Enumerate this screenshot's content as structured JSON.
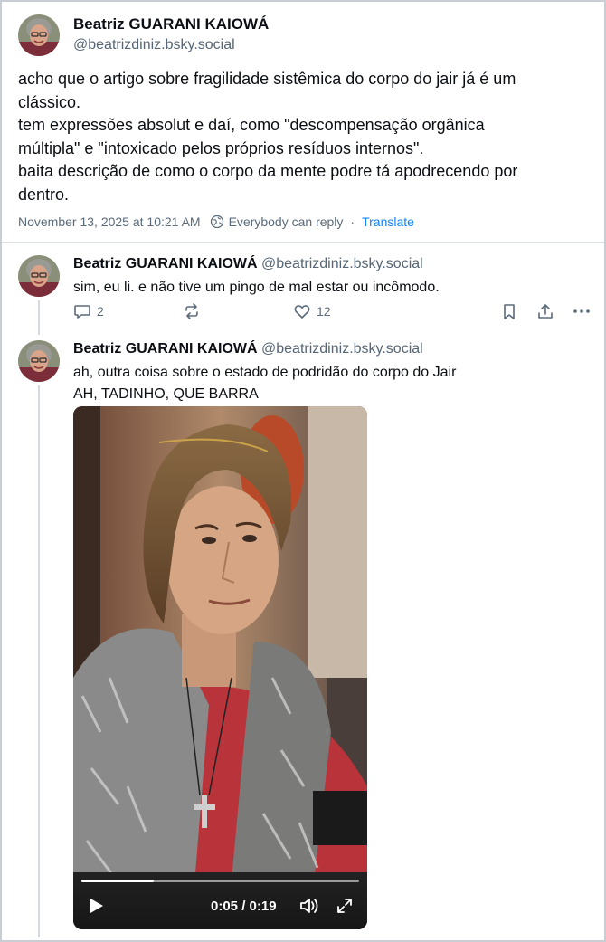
{
  "main_post": {
    "author_name": "Beatriz GUARANI KAIOWÁ",
    "author_handle": "@beatrizdiniz.bsky.social",
    "text_lines": [
      "acho que o artigo sobre fragilidade sistêmica do corpo do jair já é um",
      "clássico.",
      "tem expressões absolut e daí, como \"descompensação orgânica",
      "múltipla\" e \"intoxicado pelos próprios resíduos internos\".",
      "baita descrição de como o corpo da mente podre tá apodrecendo por",
      "dentro."
    ],
    "timestamp": "November 13, 2025 at 10:21 AM",
    "reply_setting": "Everybody can reply",
    "separator": "·",
    "translate_label": "Translate",
    "icons": {
      "avatar": "avatar",
      "globe": "globe-icon"
    }
  },
  "replies": [
    {
      "author_name": "Beatriz GUARANI KAIOWÁ",
      "author_handle": "@beatrizdiniz.bsky.social",
      "text_lines": [
        "sim, eu li. e não tive um pingo de mal estar ou incômodo."
      ],
      "reply_count": "2",
      "like_count": "12",
      "icons": [
        "reply-icon",
        "repost-icon",
        "like-icon",
        "bookmark-icon",
        "share-icon",
        "more-icon"
      ]
    },
    {
      "author_name": "Beatriz GUARANI KAIOWÁ",
      "author_handle": "@beatrizdiniz.bsky.social",
      "text_lines": [
        "ah, outra coisa sobre o estado de podridão do corpo do Jair",
        "AH, TADINHO, QUE BARRA"
      ],
      "video": {
        "time_display": "0:05 / 0:19",
        "progress_fraction": 0.26,
        "icons": [
          "play-icon",
          "volume-icon",
          "fullscreen-icon"
        ]
      }
    }
  ],
  "colors": {
    "text": "#0b0f14",
    "muted": "#566676",
    "link": "#1083fe",
    "border": "#d9dee4"
  }
}
